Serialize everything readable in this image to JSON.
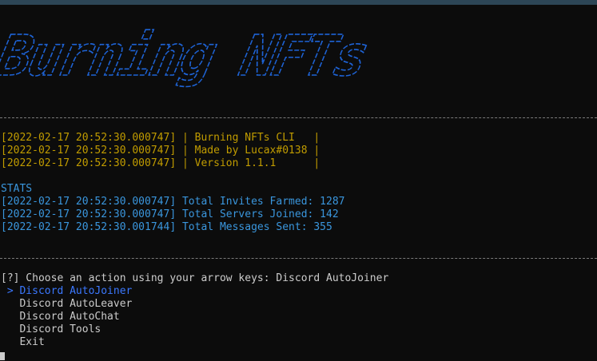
{
  "banner": {
    "text": "Burning NFTs",
    "color": "#1e63d6"
  },
  "info_lines": [
    {
      "timestamp": "[2022-02-17 20:52:30.000747]",
      "text": " | Burning NFTs CLI   |"
    },
    {
      "timestamp": "[2022-02-17 20:52:30.000747]",
      "text": " | Made by Lucax#0138 |"
    },
    {
      "timestamp": "[2022-02-17 20:52:30.000747]",
      "text": " | Version 1.1.1      |"
    }
  ],
  "stats": {
    "heading": "STATS",
    "lines": [
      {
        "timestamp": "[2022-02-17 20:52:30.000747]",
        "text": " Total Invites Farmed: 1287"
      },
      {
        "timestamp": "[2022-02-17 20:52:30.000747]",
        "text": " Total Servers Joined: 142"
      },
      {
        "timestamp": "[2022-02-17 20:52:30.001744]",
        "text": " Total Messages Sent: 355"
      }
    ]
  },
  "prompt": {
    "marker": "[?]",
    "question": " Choose an action using your arrow keys: ",
    "answer": "Discord AutoJoiner"
  },
  "menu": {
    "pointer": " > ",
    "items": [
      "Discord AutoJoiner",
      "Discord AutoLeaver",
      "Discord AutoChat",
      "Discord Tools",
      "Exit"
    ],
    "selected_index": 0
  },
  "colors": {
    "background": "#0c0c0c",
    "orange": "#c19c00",
    "blue": "#3a96dd",
    "selected": "#3b78ff",
    "text": "#cccccc"
  }
}
